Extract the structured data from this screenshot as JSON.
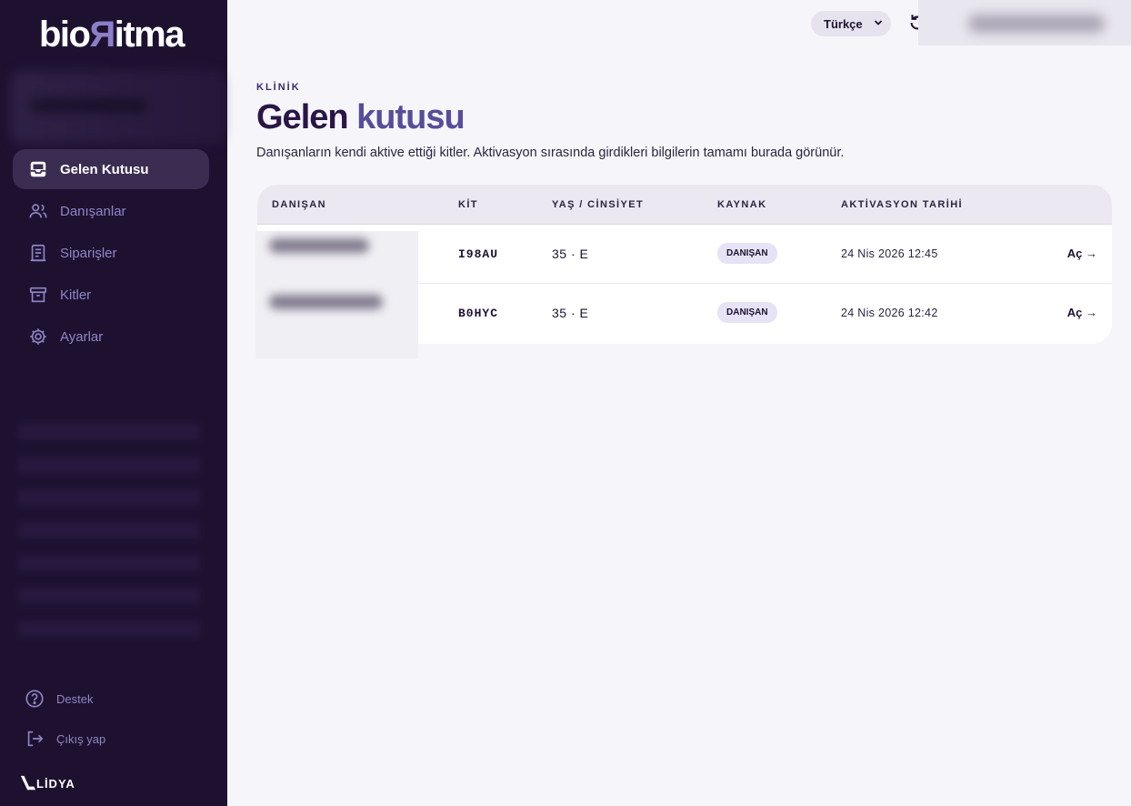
{
  "sidebar": {
    "logo": {
      "left": "bio",
      "mark": "Я",
      "right": "itma"
    },
    "nav": [
      {
        "label": "Gelen Kutusu",
        "icon": "inbox-icon",
        "active": true
      },
      {
        "label": "Danışanlar",
        "icon": "users-icon",
        "active": false
      },
      {
        "label": "Siparişler",
        "icon": "receipt-icon",
        "active": false
      },
      {
        "label": "Kitler",
        "icon": "archive-icon",
        "active": false
      },
      {
        "label": "Ayarlar",
        "icon": "gear-icon",
        "active": false
      }
    ],
    "bottom": [
      {
        "label": "Destek",
        "icon": "help-icon"
      },
      {
        "label": "Çıkış yap",
        "icon": "logout-icon"
      }
    ],
    "footer_logo": "LİDYA"
  },
  "topbar": {
    "language": "Türkçe"
  },
  "page": {
    "eyebrow": "KLİNİK",
    "title_part1": "Gelen",
    "title_part2": "kutusu",
    "subtitle": "Danışanların kendi aktive ettiği kitler. Aktivasyon sırasında girdikleri bilgilerin tamamı burada görünür."
  },
  "table": {
    "headers": [
      "DANIŞAN",
      "KİT",
      "YAŞ / CİNSİYET",
      "KAYNAK",
      "AKTİVASYON TARİHİ"
    ],
    "rows": [
      {
        "kit": "I98AU",
        "age": "35 · E",
        "source": "DANIŞAN",
        "date": "24 Nis 2026 12:45",
        "action": "Aç →"
      },
      {
        "kit": "B0HYC",
        "age": "35 · E",
        "source": "DANIŞAN",
        "date": "24 Nis 2026 12:42",
        "action": "Aç →"
      }
    ]
  }
}
